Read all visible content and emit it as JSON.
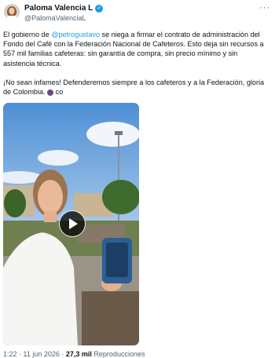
{
  "author": {
    "name": "Paloma Valencia L",
    "handle": "@PalomaValenciaL",
    "verified_icon": "verified-badge-icon"
  },
  "more_label": "···",
  "tweet": {
    "p1_pre": "El gobierno de ",
    "p1_mention": "@petrogustavo",
    "p1_post": " se niega a firmar el contrato de administración del Fondo del Café con la Federación Nacional de Cafeteros. Esto deja sin recursos a 557 mil familias cafeteras: sin garantía de compra, sin precio mínimo y sin asistencia técnica.",
    "p2": "¡No sean infames! Defenderemos siempre a los cafeteros y a la Federación, gloria de Colombia. ",
    "p2_tail": " co"
  },
  "video": {
    "play_icon": "play-icon"
  },
  "meta": {
    "time": "1:22 · 11 jun 2026 · ",
    "views": "27,3 mil",
    "views_label": " Reproducciones"
  },
  "colors": {
    "accent": "#1d9bf0",
    "text": "#0f1419",
    "muted": "#536471"
  }
}
